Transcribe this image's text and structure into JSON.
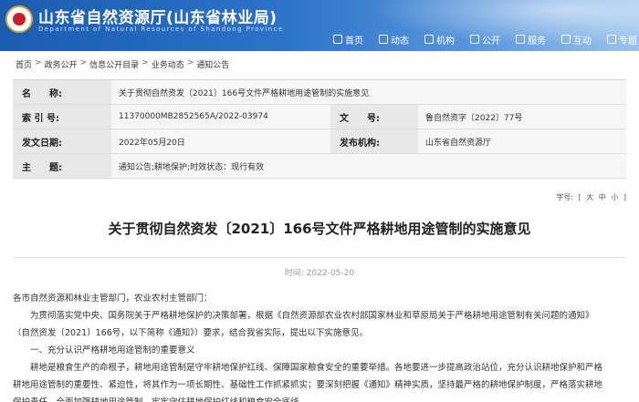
{
  "header": {
    "title": "山东省自然资源厅(山东省林业局)",
    "subtitle": "Department of Natural Resources of Shandong Province",
    "nav": [
      {
        "label": "首页",
        "icon": "home-icon"
      },
      {
        "label": "动态",
        "icon": "news-icon"
      },
      {
        "label": "机构",
        "icon": "org-icon"
      },
      {
        "label": "公开",
        "icon": "disclosure-icon"
      },
      {
        "label": "服务",
        "icon": "service-icon"
      },
      {
        "label": "互动",
        "icon": "interact-icon"
      },
      {
        "label": "专题",
        "icon": "topic-icon"
      }
    ]
  },
  "breadcrumb": [
    "首页",
    "政务公开",
    "信息公开目录",
    "业务动态",
    "通知公告"
  ],
  "info": {
    "name_label": "名　　称:",
    "name_value": "关于贯彻自然资发〔2021〕166号文件严格耕地用途管制的实施意见",
    "index_label": "索 引 号:",
    "index_value": "11370000MB2852565A/2022-03974",
    "docno_label": "文　　号:",
    "docno_value": "鲁自然资字〔2022〕77号",
    "date_label": "发文日期:",
    "date_value": "2022年05月20日",
    "org_label": "发布机构:",
    "org_value": "山东省自然资源厅",
    "subject_label": "主　　题:",
    "subject_value": "通知公告;耕地保护;时效状态：现行有效"
  },
  "fontsize": {
    "label": "字号:",
    "open": "[",
    "large": "大",
    "medium": "中",
    "small": "小",
    "close": "]"
  },
  "article": {
    "title": "关于贯彻自然资发〔2021〕166号文件严格耕地用途管制的实施意见",
    "time_label": "时间:",
    "time_value": "2022-05-20",
    "paragraphs": [
      "各市自然资源和林业主管部门，农业农村主管部门：",
      "为贯彻落实党中央、国务院关于严格耕地保护的决策部署，根据《自然资源部农业农村部国家林业和草原局关于严格耕地用途管制有关问题的通知》",
      "（自然资发〔2021〕166号，以下简称《通知》）要求，结合我省实际，提出以下实施意见。",
      "一、充分认识严格耕地用途管制的重要意义",
      "耕地是粮食生产的命根子，耕地用途管制是守牢耕地保护红线、保障国家粮食安全的重要举措。各地要进一步提高政治站位，充分认识耕地保护和严格",
      "耕地用途管制的重要性、紧迫性，将其作为一项长期性、基础性工作抓紧抓实；要深刻把握《通知》精神实质，坚持最严格的耕地保护制度，严格落实耕地",
      "保护责任，全面加强耕地用途管制，牢牢守住耕地保护红线和粮食安全底线。"
    ]
  }
}
